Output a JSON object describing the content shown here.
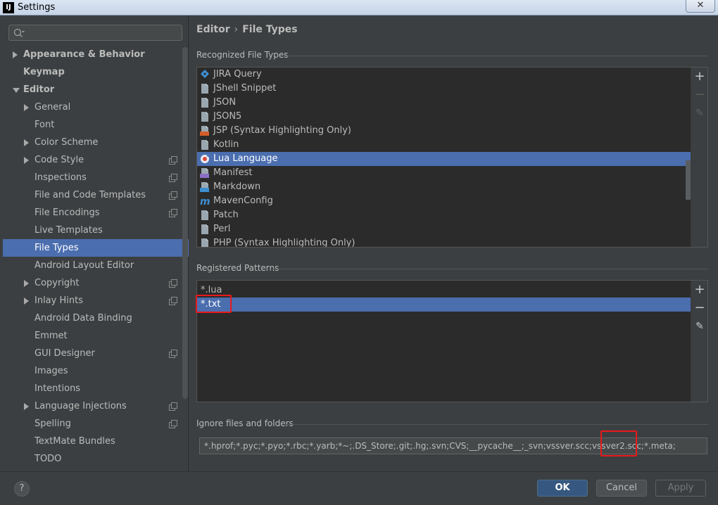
{
  "window": {
    "title": "Settings",
    "app_icon_text": "IJ",
    "close_symbol": "✕"
  },
  "search": {
    "placeholder": "",
    "value": ""
  },
  "sidebar": {
    "items": [
      {
        "label": "Appearance & Behavior",
        "arrow": "right",
        "indent": 0,
        "bold": true,
        "proj": false,
        "selected": false
      },
      {
        "label": "Keymap",
        "arrow": "none",
        "indent": 0,
        "bold": true,
        "proj": false,
        "selected": false
      },
      {
        "label": "Editor",
        "arrow": "down",
        "indent": 0,
        "bold": true,
        "proj": false,
        "selected": false
      },
      {
        "label": "General",
        "arrow": "right",
        "indent": 1,
        "bold": false,
        "proj": false,
        "selected": false
      },
      {
        "label": "Font",
        "arrow": "none",
        "indent": 1,
        "bold": false,
        "proj": false,
        "selected": false
      },
      {
        "label": "Color Scheme",
        "arrow": "right",
        "indent": 1,
        "bold": false,
        "proj": false,
        "selected": false
      },
      {
        "label": "Code Style",
        "arrow": "right",
        "indent": 1,
        "bold": false,
        "proj": true,
        "selected": false
      },
      {
        "label": "Inspections",
        "arrow": "none",
        "indent": 1,
        "bold": false,
        "proj": true,
        "selected": false
      },
      {
        "label": "File and Code Templates",
        "arrow": "none",
        "indent": 1,
        "bold": false,
        "proj": true,
        "selected": false
      },
      {
        "label": "File Encodings",
        "arrow": "none",
        "indent": 1,
        "bold": false,
        "proj": true,
        "selected": false
      },
      {
        "label": "Live Templates",
        "arrow": "none",
        "indent": 1,
        "bold": false,
        "proj": false,
        "selected": false
      },
      {
        "label": "File Types",
        "arrow": "none",
        "indent": 1,
        "bold": false,
        "proj": false,
        "selected": true
      },
      {
        "label": "Android Layout Editor",
        "arrow": "none",
        "indent": 1,
        "bold": false,
        "proj": false,
        "selected": false
      },
      {
        "label": "Copyright",
        "arrow": "right",
        "indent": 1,
        "bold": false,
        "proj": true,
        "selected": false
      },
      {
        "label": "Inlay Hints",
        "arrow": "right",
        "indent": 1,
        "bold": false,
        "proj": true,
        "selected": false
      },
      {
        "label": "Android Data Binding",
        "arrow": "none",
        "indent": 1,
        "bold": false,
        "proj": false,
        "selected": false
      },
      {
        "label": "Emmet",
        "arrow": "none",
        "indent": 1,
        "bold": false,
        "proj": false,
        "selected": false
      },
      {
        "label": "GUI Designer",
        "arrow": "none",
        "indent": 1,
        "bold": false,
        "proj": true,
        "selected": false
      },
      {
        "label": "Images",
        "arrow": "none",
        "indent": 1,
        "bold": false,
        "proj": false,
        "selected": false
      },
      {
        "label": "Intentions",
        "arrow": "none",
        "indent": 1,
        "bold": false,
        "proj": false,
        "selected": false
      },
      {
        "label": "Language Injections",
        "arrow": "right",
        "indent": 1,
        "bold": false,
        "proj": true,
        "selected": false
      },
      {
        "label": "Spelling",
        "arrow": "none",
        "indent": 1,
        "bold": false,
        "proj": true,
        "selected": false
      },
      {
        "label": "TextMate Bundles",
        "arrow": "none",
        "indent": 1,
        "bold": false,
        "proj": false,
        "selected": false
      },
      {
        "label": "TODO",
        "arrow": "none",
        "indent": 1,
        "bold": false,
        "proj": false,
        "selected": false
      }
    ]
  },
  "breadcrumb": {
    "parent": "Editor",
    "separator": "›",
    "current": "File Types"
  },
  "recognized": {
    "title": "Recognized File Types",
    "items": [
      {
        "label": "JIRA Query",
        "icon": "jira-icon",
        "color": "#3d8fd1",
        "selected": false
      },
      {
        "label": "JShell Snippet",
        "icon": "file-icon",
        "color": "#8c9aa6",
        "selected": false
      },
      {
        "label": "JSON",
        "icon": "file-icon",
        "color": "#8c9aa6",
        "selected": false
      },
      {
        "label": "JSON5",
        "icon": "file-icon",
        "color": "#8c9aa6",
        "selected": false
      },
      {
        "label": "JSP (Syntax Highlighting Only)",
        "icon": "jsp-icon",
        "color": "#d35e2a",
        "selected": false
      },
      {
        "label": "Kotlin",
        "icon": "file-icon",
        "color": "#8c9aa6",
        "selected": false
      },
      {
        "label": "Lua Language",
        "icon": "lua-icon",
        "color": "#e0463a",
        "selected": true
      },
      {
        "label": "Manifest",
        "icon": "manifest-icon",
        "color": "#8c6ec8",
        "selected": false
      },
      {
        "label": "Markdown",
        "icon": "markdown-icon",
        "color": "#3d8fd1",
        "selected": false
      },
      {
        "label": "MavenConfig",
        "icon": "maven-icon",
        "color": "#3d8fd1",
        "selected": false
      },
      {
        "label": "Patch",
        "icon": "file-icon",
        "color": "#8c9aa6",
        "selected": false
      },
      {
        "label": "Perl",
        "icon": "file-icon",
        "color": "#8c9aa6",
        "selected": false
      },
      {
        "label": "PHP (Syntax Highlighting Only)",
        "icon": "file-icon",
        "color": "#8c9aa6",
        "selected": false
      }
    ]
  },
  "patterns": {
    "title": "Registered Patterns",
    "items": [
      {
        "label": "*.lua",
        "selected": false
      },
      {
        "label": "*.txt",
        "selected": true
      }
    ]
  },
  "tools": {
    "add": "+",
    "remove": "−",
    "edit": "✎"
  },
  "ignore": {
    "title": "Ignore files and folders",
    "value": "*.hprof;*.pyc;*.pyo;*.rbc;*.yarb;*~;.DS_Store;.git;.hg;.svn;CVS;__pycache__;_svn;vssver.scc;vssver2.scc;*.meta;"
  },
  "buttons": {
    "help": "?",
    "ok": "OK",
    "cancel": "Cancel",
    "apply": "Apply"
  },
  "colors": {
    "selection": "#4b6eaf",
    "highlight_box": "#e8191c",
    "accent_button": "#365880"
  }
}
